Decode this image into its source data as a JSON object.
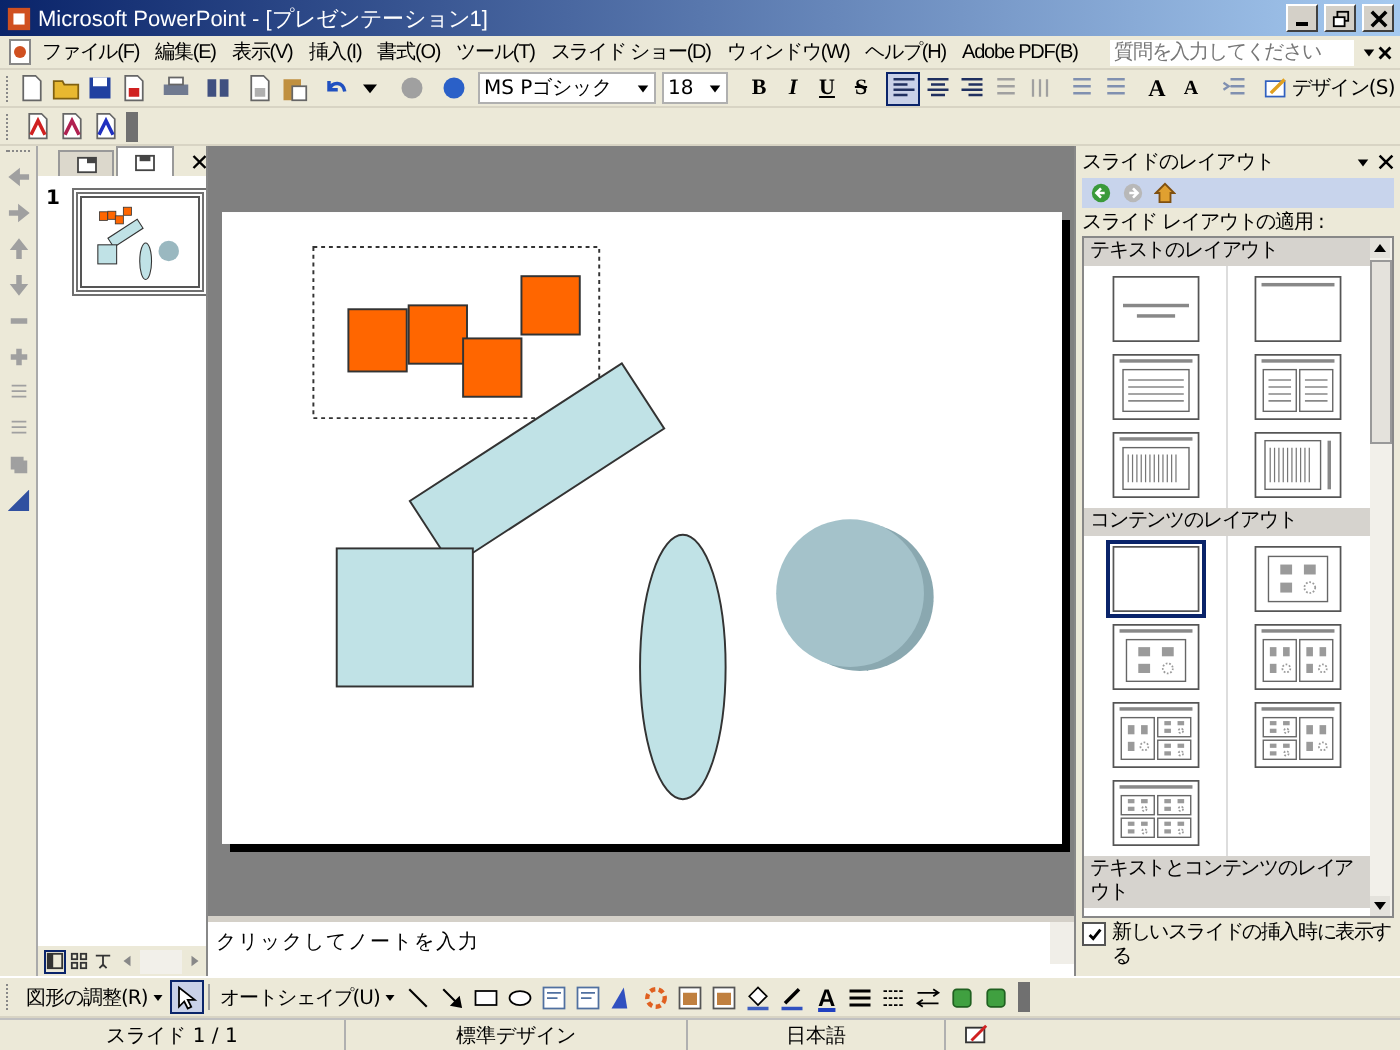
{
  "window": {
    "title": "Microsoft PowerPoint - [プレゼンテーション1]"
  },
  "menu": {
    "items": [
      "ファイル(F)",
      "編集(E)",
      "表示(V)",
      "挿入(I)",
      "書式(O)",
      "ツール(T)",
      "スライド ショー(D)",
      "ウィンドウ(W)",
      "ヘルプ(H)",
      "Adobe PDF(B)"
    ],
    "help_placeholder": "質問を入力してください"
  },
  "formatting": {
    "font": "MS Pゴシック",
    "size": "18",
    "styles": [
      "B",
      "I",
      "U",
      "S"
    ],
    "align": [
      {
        "selected": true
      },
      {
        "selected": false
      },
      {
        "selected": false
      }
    ],
    "grow": [
      "A",
      "A"
    ],
    "design": "デザイン(S)"
  },
  "slide_panel": {
    "tabs": [
      {
        "selected": false
      },
      {
        "selected": true
      }
    ],
    "slides": [
      {
        "number": "1",
        "selected": true
      }
    ]
  },
  "notes": {
    "text": "クリックしてノートを入力"
  },
  "task_pane": {
    "title": "スライドのレイアウト",
    "label": "スライド レイアウトの適用 :",
    "sections": [
      {
        "title": "テキストのレイアウト",
        "layouts": [
          {
            "kind": "title",
            "selected": false
          },
          {
            "kind": "titleonly",
            "selected": false
          },
          {
            "kind": "bullets",
            "selected": false
          },
          {
            "kind": "twobullets",
            "selected": false
          },
          {
            "kind": "vertical",
            "selected": false
          },
          {
            "kind": "vertical2",
            "selected": false
          }
        ]
      },
      {
        "title": "コンテンツのレイアウト",
        "layouts": [
          {
            "kind": "blank",
            "selected": true
          },
          {
            "kind": "content",
            "selected": false
          },
          {
            "kind": "titlecontent",
            "selected": false
          },
          {
            "kind": "twocontent",
            "selected": false
          },
          {
            "kind": "bigleft",
            "selected": false
          },
          {
            "kind": "bigright",
            "selected": false
          },
          {
            "kind": "four",
            "selected": false
          }
        ]
      },
      {
        "title": "テキストとコンテンツのレイアウト"
      }
    ],
    "show_on_insert": {
      "label": "新しいスライドの挿入時に表示する",
      "checked": true
    }
  },
  "drawing_toolbar": {
    "draw_menu": "図形の調整(R)",
    "pointer_selected": true,
    "autoshapes": "オートシェイプ(U)",
    "font_color": "A"
  },
  "status_bar": [
    "スライド 1 / 1",
    "標準デザイン",
    "日本語"
  ]
}
